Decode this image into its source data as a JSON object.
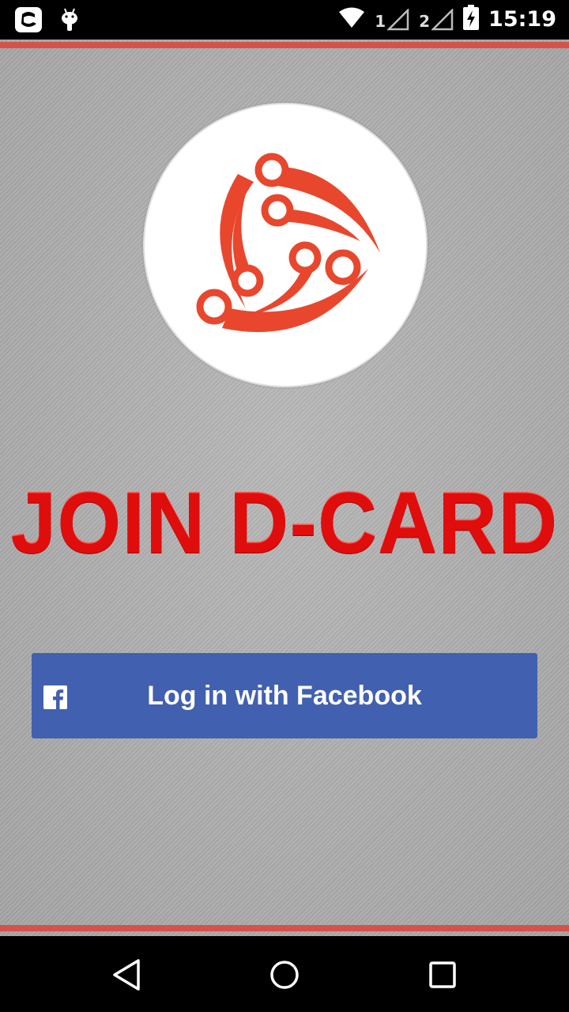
{
  "status_bar": {
    "time": "15:19",
    "sim1_label": "1",
    "sim2_label": "2",
    "icons": [
      "app-notification-icon",
      "android-debug-icon",
      "wifi-icon",
      "signal-icon",
      "battery-charging-icon"
    ]
  },
  "app": {
    "title": "JOIN D-CARD",
    "logo_name": "d-card-logo",
    "facebook_button": {
      "label": "Log in with Facebook",
      "icon": "facebook-icon"
    },
    "colors": {
      "accent_red": "#d5524b",
      "title_red": "#e00d0d",
      "facebook_blue": "#4260b0",
      "logo_orange": "#e8472d"
    }
  },
  "nav_bar": {
    "icons": [
      "back-icon",
      "home-icon",
      "recents-icon"
    ]
  }
}
